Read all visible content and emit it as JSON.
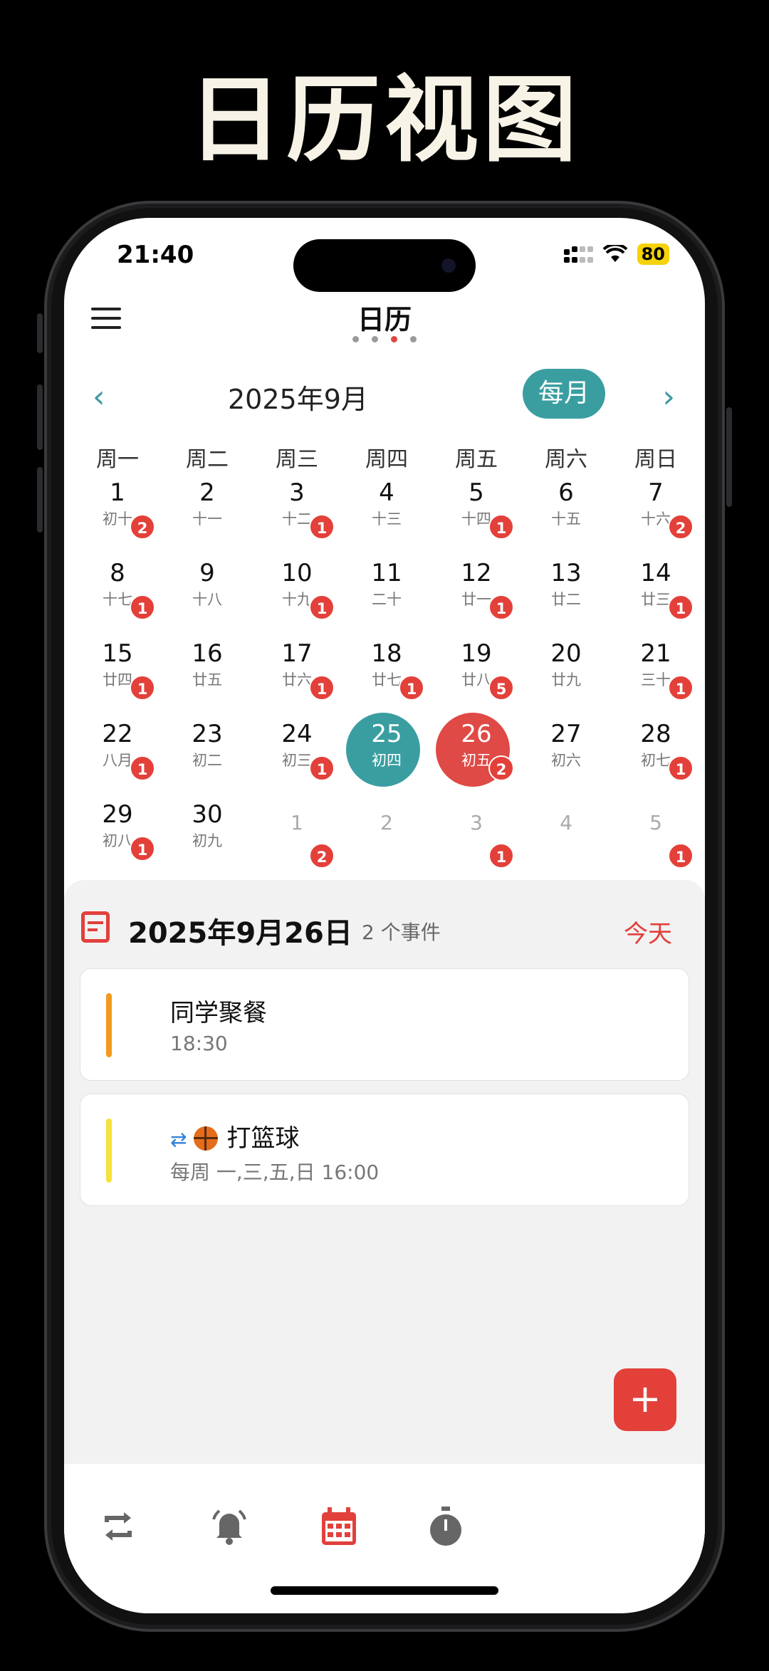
{
  "hero_title": "日历视图",
  "status": {
    "time": "21:40",
    "battery": "80"
  },
  "header": {
    "title": "日历"
  },
  "calendar": {
    "month_label": "2025年9月",
    "mode_button": "每月",
    "weekdays": [
      "周一",
      "周二",
      "周三",
      "周四",
      "周五",
      "周六",
      "周日"
    ],
    "days": [
      {
        "n": "1",
        "l": "初十",
        "b": "2"
      },
      {
        "n": "2",
        "l": "十一",
        "b": ""
      },
      {
        "n": "3",
        "l": "十二",
        "b": "1"
      },
      {
        "n": "4",
        "l": "十三",
        "b": ""
      },
      {
        "n": "5",
        "l": "十四",
        "b": "1"
      },
      {
        "n": "6",
        "l": "十五",
        "b": ""
      },
      {
        "n": "7",
        "l": "十六",
        "b": "2"
      },
      {
        "n": "8",
        "l": "十七",
        "b": "1"
      },
      {
        "n": "9",
        "l": "十八",
        "b": ""
      },
      {
        "n": "10",
        "l": "十九",
        "b": "1"
      },
      {
        "n": "11",
        "l": "二十",
        "b": ""
      },
      {
        "n": "12",
        "l": "廿一",
        "b": "1"
      },
      {
        "n": "13",
        "l": "廿二",
        "b": ""
      },
      {
        "n": "14",
        "l": "廿三",
        "b": "1"
      },
      {
        "n": "15",
        "l": "廿四",
        "b": "1"
      },
      {
        "n": "16",
        "l": "廿五",
        "b": ""
      },
      {
        "n": "17",
        "l": "廿六",
        "b": "1"
      },
      {
        "n": "18",
        "l": "廿七",
        "b": "1"
      },
      {
        "n": "19",
        "l": "廿八",
        "b": "5"
      },
      {
        "n": "20",
        "l": "廿九",
        "b": ""
      },
      {
        "n": "21",
        "l": "三十",
        "b": "1"
      },
      {
        "n": "22",
        "l": "八月",
        "b": "1"
      },
      {
        "n": "23",
        "l": "初二",
        "b": ""
      },
      {
        "n": "24",
        "l": "初三",
        "b": "1"
      },
      {
        "n": "25",
        "l": "初四",
        "b": "",
        "s": "today"
      },
      {
        "n": "26",
        "l": "初五",
        "b": "2",
        "s": "sel"
      },
      {
        "n": "27",
        "l": "初六",
        "b": ""
      },
      {
        "n": "28",
        "l": "初七",
        "b": "1"
      },
      {
        "n": "29",
        "l": "初八",
        "b": "1"
      },
      {
        "n": "30",
        "l": "初九",
        "b": ""
      },
      {
        "n": "1",
        "l": "",
        "b": "2",
        "s": "other"
      },
      {
        "n": "2",
        "l": "",
        "b": "",
        "s": "other"
      },
      {
        "n": "3",
        "l": "",
        "b": "1",
        "s": "other"
      },
      {
        "n": "4",
        "l": "",
        "b": "",
        "s": "other"
      },
      {
        "n": "5",
        "l": "",
        "b": "1",
        "s": "other"
      }
    ]
  },
  "panel": {
    "date": "2025年9月26日",
    "count": "2 个事件",
    "today": "今天",
    "events": [
      {
        "name": "同学聚餐",
        "time": "18:30",
        "color": "#f39a1e",
        "repeat": false
      },
      {
        "name": "打篮球",
        "time": "每周  一,三,五,日 16:00",
        "color": "#f5e23c",
        "repeat": true
      }
    ]
  },
  "fab": "+",
  "tabs": [
    "repeat-icon",
    "bell-icon",
    "calendar-icon",
    "timer-icon"
  ],
  "colors": {
    "teal": "#3a9ea1",
    "red": "#e2403b"
  }
}
